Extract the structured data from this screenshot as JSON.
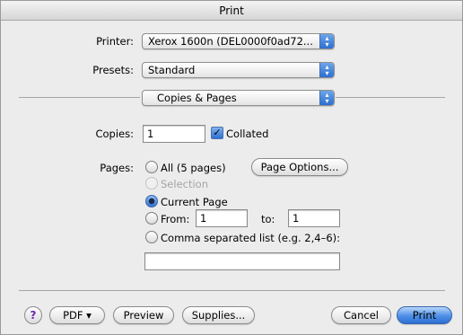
{
  "window": {
    "title": "Print"
  },
  "printer": {
    "label": "Printer:",
    "value": "Xerox 1600n (DEL0000f0ad72..."
  },
  "presets": {
    "label": "Presets:",
    "value": "Standard"
  },
  "section": {
    "value": "Copies & Pages"
  },
  "copies": {
    "label": "Copies:",
    "value": "1",
    "collated_label": "Collated",
    "collated_checked": true
  },
  "pages": {
    "label": "Pages:",
    "all_label": "All (5 pages)",
    "page_options_label": "Page Options...",
    "selection_label": "Selection",
    "current_label": "Current Page",
    "from_label": "From:",
    "from_value": "1",
    "to_label": "to:",
    "to_value": "1",
    "comma_label": "Comma separated list (e.g. 2,4–6):",
    "comma_value": "",
    "selected": "current"
  },
  "footer": {
    "help_label": "?",
    "pdf_label": "PDF ▾",
    "preview_label": "Preview",
    "supplies_label": "Supplies...",
    "cancel_label": "Cancel",
    "print_label": "Print"
  },
  "colors": {
    "accent": "#2c6fd0",
    "window_bg": "#ececec"
  }
}
